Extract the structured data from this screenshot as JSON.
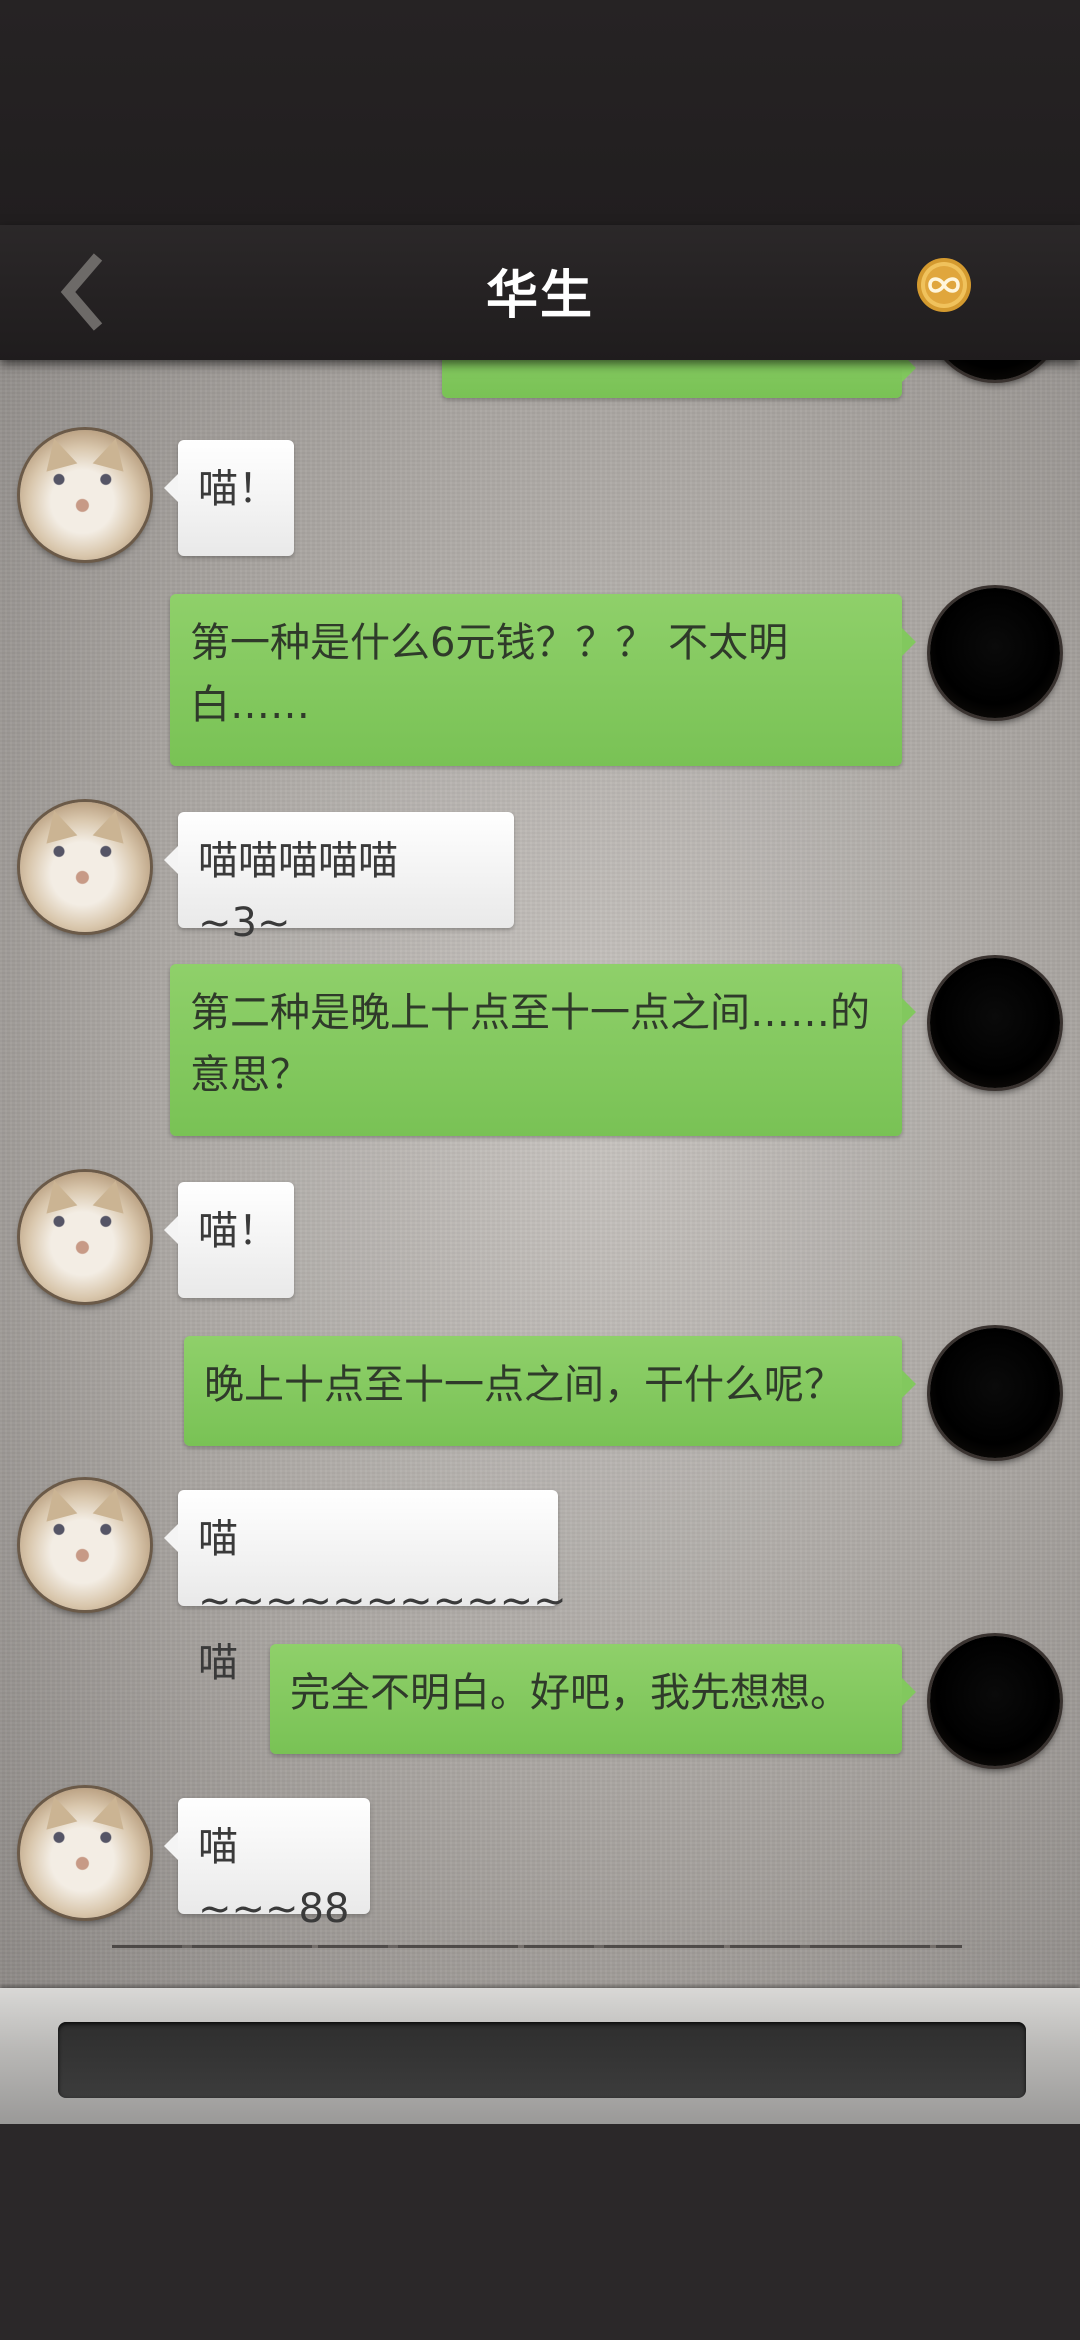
{
  "header": {
    "title": "华生",
    "back_icon": "chevron-left-icon",
    "coin_icon": "infinity-coin-icon"
  },
  "messages": [
    {
      "from": "self",
      "text": ""
    },
    {
      "from": "cat",
      "text": "喵！"
    },
    {
      "from": "self",
      "text": "第一种是什么6元钱？？？ 不太明白……"
    },
    {
      "from": "cat",
      "text": "喵喵喵喵喵 ~3~"
    },
    {
      "from": "self",
      "text": "第二种是晚上十点至十一点之间……的意思？"
    },
    {
      "from": "cat",
      "text": "喵！"
    },
    {
      "from": "self",
      "text": "晚上十点至十一点之间，干什么呢？"
    },
    {
      "from": "cat",
      "text": "喵~~~~~~~~~~~喵"
    },
    {
      "from": "self",
      "text": "完全不明白。好吧，我先想想。"
    },
    {
      "from": "cat",
      "text": "喵~~~88"
    }
  ],
  "input": {
    "placeholder": "",
    "value": ""
  },
  "colors": {
    "outgoing_bubble": "#82c85e",
    "incoming_bubble": "#f4f4f4",
    "nav_bar": "#262324",
    "coin": "#d9a23b"
  }
}
